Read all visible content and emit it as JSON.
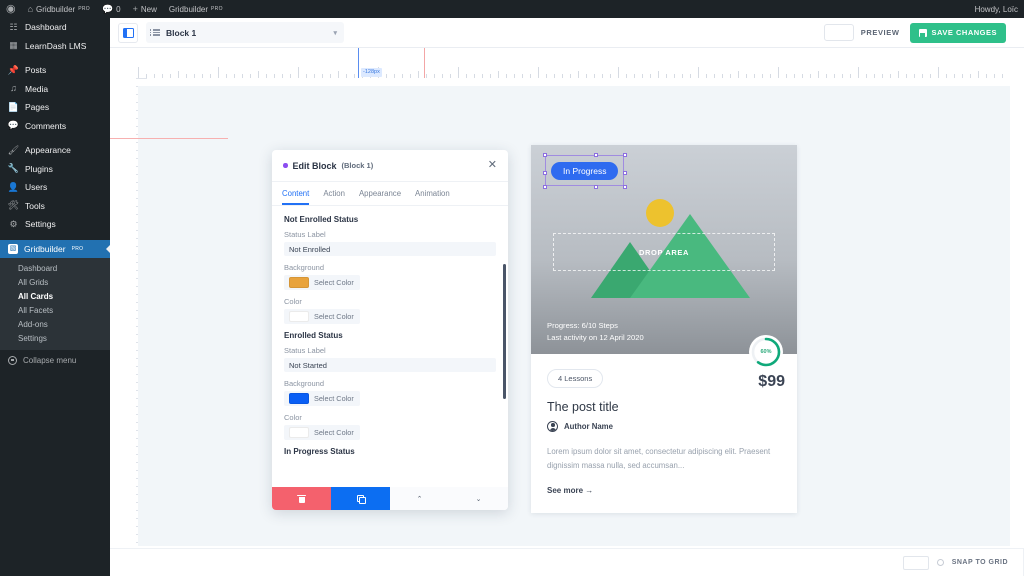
{
  "adminbar": {
    "wp_logo": "wordpress-logo-icon",
    "site": {
      "icon": "home-icon",
      "label": "Gridbuilder",
      "sup": "PRO"
    },
    "comments": {
      "icon": "comment-icon",
      "count": "0"
    },
    "new": {
      "icon": "plus-icon",
      "label": "New"
    },
    "plugin": {
      "label": "Gridbuilder",
      "sup": "PRO"
    },
    "howdy": "Howdy, Loïc"
  },
  "sidebar": {
    "items": [
      {
        "label": "Dashboard",
        "icon": "dashboard-icon"
      },
      {
        "label": "LearnDash LMS",
        "icon": "learndash-icon"
      },
      {
        "sep": true
      },
      {
        "label": "Posts",
        "icon": "pin-icon"
      },
      {
        "label": "Media",
        "icon": "media-icon"
      },
      {
        "label": "Pages",
        "icon": "page-icon"
      },
      {
        "label": "Comments",
        "icon": "comment-icon"
      },
      {
        "sep": true
      },
      {
        "label": "Appearance",
        "icon": "brush-icon"
      },
      {
        "label": "Plugins",
        "icon": "plugin-icon"
      },
      {
        "label": "Users",
        "icon": "users-icon"
      },
      {
        "label": "Tools",
        "icon": "tools-icon"
      },
      {
        "label": "Settings",
        "icon": "settings-icon"
      }
    ],
    "current": {
      "label": "Gridbuilder",
      "sup": "PRO",
      "icon": "gridbuilder-icon"
    },
    "submenu": [
      {
        "label": "Dashboard",
        "active": false
      },
      {
        "label": "All Grids",
        "active": false
      },
      {
        "label": "All Cards",
        "active": true
      },
      {
        "label": "All Facets",
        "active": false
      },
      {
        "label": "Add-ons",
        "active": false
      },
      {
        "label": "Settings",
        "active": false
      }
    ],
    "collapse": {
      "label": "Collapse menu",
      "icon": "collapse-icon"
    }
  },
  "topbar": {
    "panel_toggle": "panel-toggle-icon",
    "block_select": {
      "icon": "list-icon",
      "value": "Block 1",
      "caret": "▾"
    },
    "preview_label": "PREVIEW",
    "save_label": "SAVE CHANGES",
    "save_icon": "floppy-disk-icon",
    "save_color": "#2fc08a"
  },
  "ruler": {
    "guide_label": "-128px",
    "guide_color": "#3b7ae0",
    "red_guide_color": "#f7b0b0"
  },
  "edit_panel": {
    "title": "Edit Block",
    "subtitle": "(Block 1)",
    "close": "✕",
    "tabs": [
      {
        "label": "Content",
        "active": true
      },
      {
        "label": "Action",
        "active": false
      },
      {
        "label": "Appearance",
        "active": false
      },
      {
        "label": "Animation",
        "active": false
      }
    ],
    "sections": [
      {
        "title": "Not Enrolled Status",
        "status_label_caption": "Status Label",
        "status_label_value": "Not Enrolled",
        "background_caption": "Background",
        "background_swatch": "#e8a33d",
        "background_button": "Select Color",
        "color_caption": "Color",
        "color_swatch": "#ffffff",
        "color_button": "Select Color"
      },
      {
        "title": "Enrolled Status",
        "status_label_caption": "Status Label",
        "status_label_value": "Not Started",
        "background_caption": "Background",
        "background_swatch": "#0a5ff5",
        "background_button": "Select Color",
        "color_caption": "Color",
        "color_swatch": "#ffffff",
        "color_button": "Select Color"
      },
      {
        "title": "In Progress Status"
      }
    ],
    "footer": [
      {
        "name": "delete",
        "icon": "trash-icon",
        "color": "#f4616d"
      },
      {
        "name": "duplicate",
        "icon": "copy-icon",
        "color": "#0c6ef2"
      },
      {
        "name": "move-up",
        "icon": "chevron-up-icon",
        "glyph": "⌃"
      },
      {
        "name": "move-down",
        "icon": "chevron-down-icon",
        "glyph": "⌄"
      }
    ]
  },
  "card": {
    "status_badge": "In Progress",
    "badge_color": "#2f6bf0",
    "drop_area": "DROP AREA",
    "progress_line": "Progress: 6/10 Steps",
    "activity_line": "Last activity on 12 April 2020",
    "progress_percent": "60%",
    "progress_value": 60,
    "progress_color": "#0fa97a",
    "price": "$99",
    "lessons_pill": "4 Lessons",
    "title": "The post title",
    "author": "Author Name",
    "excerpt": "Lorem ipsum dolor sit amet, consectetur adipiscing elit. Praesent dignissim massa nulla, sed accumsan...",
    "see_more": "See more →"
  },
  "bottombar": {
    "snap_label": "SNAP TO GRID",
    "snap_toggle": "snap-toggle"
  }
}
